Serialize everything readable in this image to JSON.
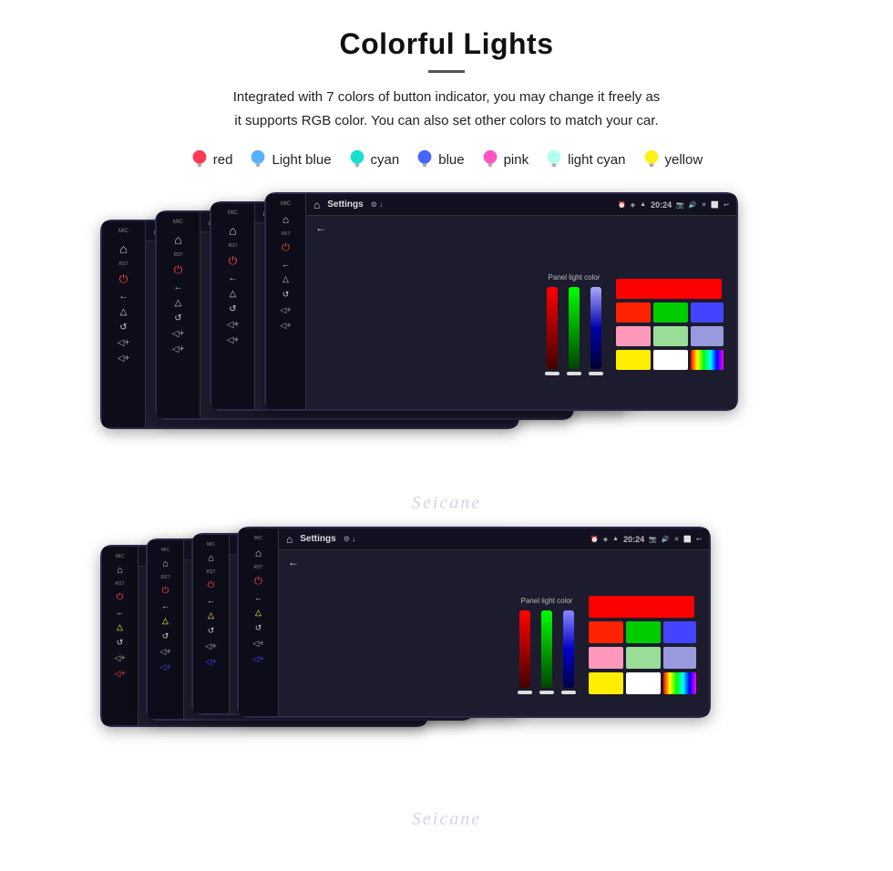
{
  "page": {
    "title": "Colorful Lights",
    "description": "Integrated with 7 colors of button indicator, you may change it freely as\nit supports RGB color. You can also set other colors to match your car.",
    "colors": [
      {
        "name": "red",
        "color": "#ff2244",
        "bulb_color": "#ff2244"
      },
      {
        "name": "Light blue",
        "color": "#44aaff",
        "bulb_color": "#44aaff"
      },
      {
        "name": "cyan",
        "color": "#00ffee",
        "bulb_color": "#00ffee"
      },
      {
        "name": "blue",
        "color": "#4466ff",
        "bulb_color": "#4466ff"
      },
      {
        "name": "pink",
        "color": "#ff44aa",
        "bulb_color": "#ff44aa"
      },
      {
        "name": "light cyan",
        "color": "#aaffee",
        "bulb_color": "#aaffee"
      },
      {
        "name": "yellow",
        "color": "#ffee00",
        "bulb_color": "#ffee00"
      }
    ],
    "top_bar": {
      "settings_label": "Settings",
      "time": "20:24"
    },
    "panel_light_label": "Panel light color",
    "watermark": "Seicane",
    "color_grid_top": [
      [
        "#ff0000"
      ],
      [
        "#ff0000",
        "#00cc00",
        "#4444ff"
      ],
      [
        "#ff99aa",
        "#99ff99",
        "#9999ff"
      ],
      [
        "#ffee00",
        "#ffffff",
        "#rainbow"
      ]
    ],
    "color_grid_bottom": [
      [
        "#ff0000"
      ],
      [
        "#ff0000",
        "#00cc00",
        "#4444ff"
      ],
      [
        "#ff99aa",
        "#99ff99",
        "#9999ff"
      ],
      [
        "#ffee00",
        "#ffffff",
        "#rainbow"
      ]
    ]
  }
}
